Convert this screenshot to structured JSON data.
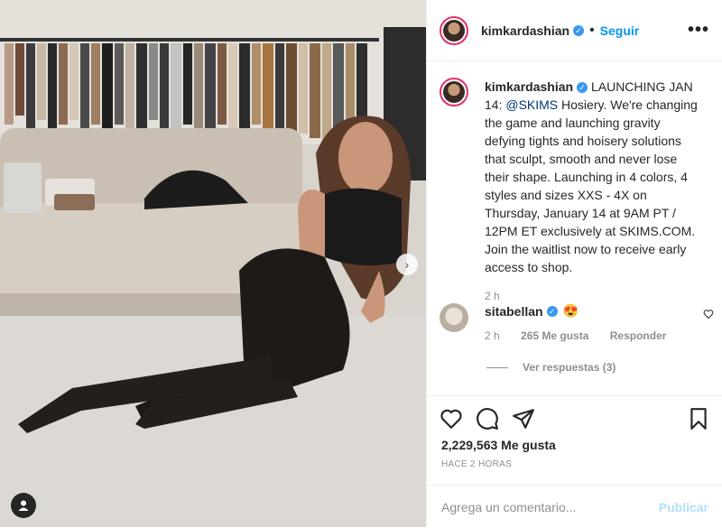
{
  "post": {
    "username": "kimkardashian",
    "follow_label": "Seguir",
    "more_label": "•••",
    "caption_user": "kimkardashian",
    "caption_lead": "LAUNCHING JAN 14:",
    "caption_mention": "@SKIMS",
    "caption_body": "Hosiery. We're changing the game and launching gravity defying tights and hoisery solutions that sculpt, smooth and never lose their shape. Launching in 4 colors, 4 styles and sizes XXS - 4X on Thursday, January 14 at 9AM PT / 12PM ET exclusively at SKIMS.COM. Join the waitlist now to receive early access to shop.",
    "caption_time": "2 h"
  },
  "comment": {
    "username": "sitabellan",
    "emoji": "😍",
    "time": "2 h",
    "likes": "265 Me gusta",
    "reply": "Responder",
    "view_replies": "Ver respuestas (3)"
  },
  "footer": {
    "likes": "2,229,563 Me gusta",
    "ago": "HACE 2 HORAS",
    "comment_placeholder": "Agrega un comentario...",
    "publish": "Publicar"
  },
  "colors": {
    "link": "#0095f6",
    "verified": "#3897f0",
    "muted": "#8e8e8e"
  }
}
